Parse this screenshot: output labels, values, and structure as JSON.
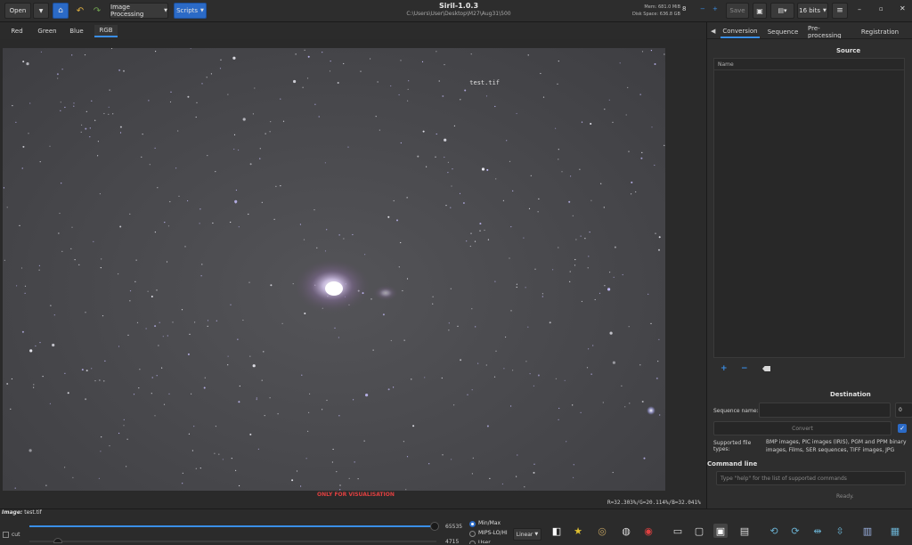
{
  "header": {
    "open_label": "Open",
    "image_processing_label": "Image Processing",
    "scripts_label": "Scripts",
    "app_title": "Siril-1.0.3",
    "path": "C:\\Users\\User\\Desktop\\M27\\Aug31\\500",
    "mem": "Mem: 681.0 MiB",
    "disk": "Disk Space: 636.8 GB",
    "threads": "8",
    "save_label": "Save",
    "bits_label": "16 bits"
  },
  "channels": [
    "Red",
    "Green",
    "Blue",
    "RGB"
  ],
  "image": {
    "filename": "test.tif",
    "vis_note": "ONLY FOR VISUALISATION",
    "pixel_value": "R=32.303%/G=20.114%/B=32.041%"
  },
  "right_panel": {
    "tabs": [
      "Conversion",
      "Sequence",
      "Pre-processing",
      "Registration"
    ],
    "source_title": "Source",
    "list_header": "Name",
    "destination_title": "Destination",
    "sequence_name_label": "Sequence name:",
    "seq_start": "0",
    "convert_label": "Convert",
    "supported_label": "Supported file types:",
    "supported_text": "BMP images, PIC images (IRIS), PGM and PPM binary images, Films, SER sequences, TIFF images, JPG images,",
    "command_title": "Command line",
    "command_placeholder": "Type \"help\" for the list of supported commands",
    "status": "Ready."
  },
  "bottom": {
    "image_label": "Image:",
    "image_name": "test.tif",
    "cut_label": "cut",
    "hi_value": "65535",
    "lo_value": "4715",
    "minmax_label": "Min/Max",
    "mips_label": "MIPS-LO/HI",
    "user_label": "User",
    "scale_label": "Linear"
  }
}
